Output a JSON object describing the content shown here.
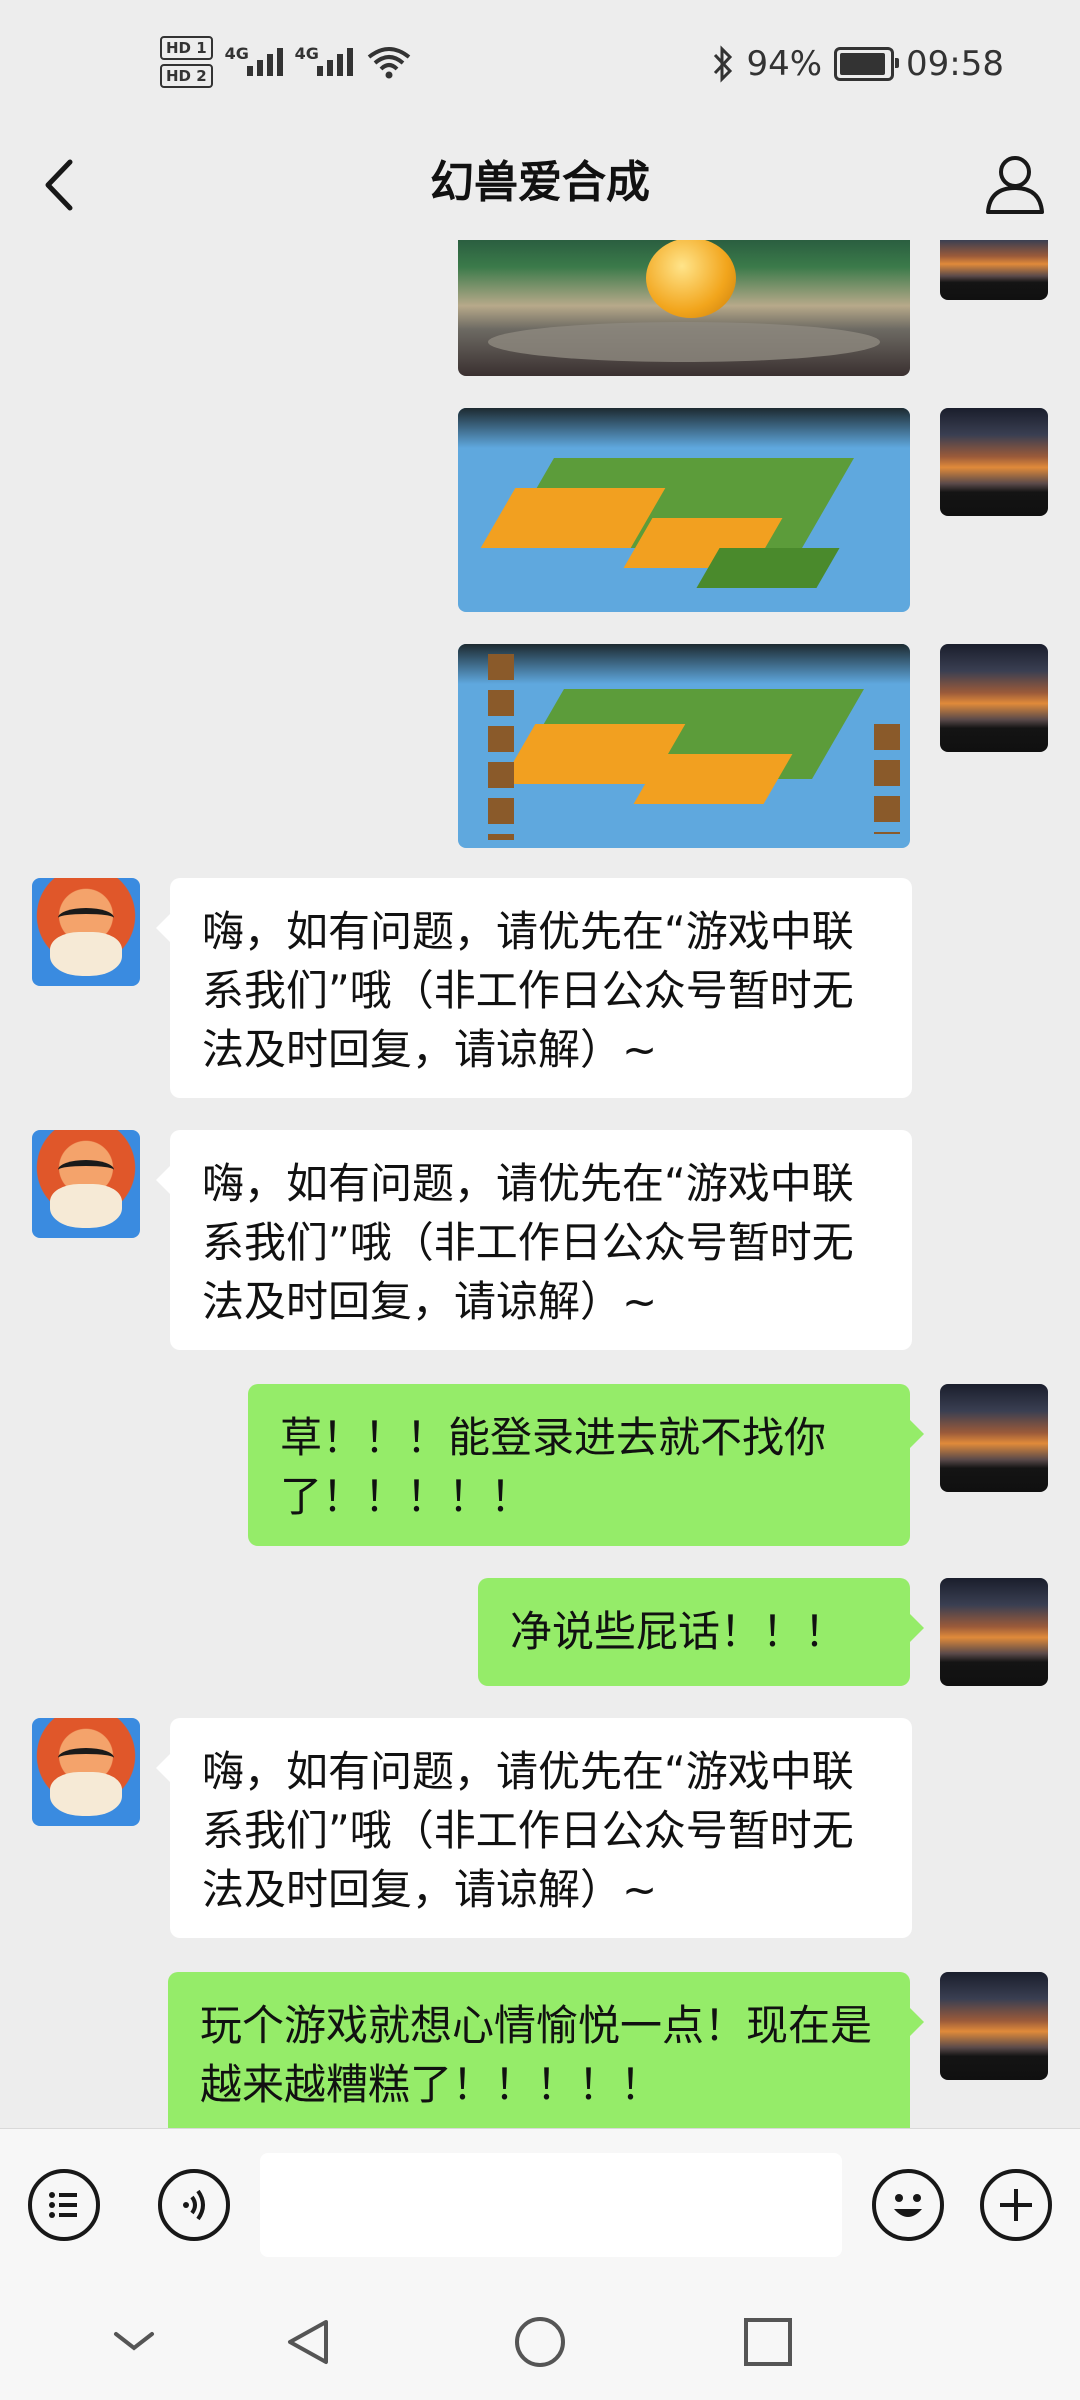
{
  "status_bar": {
    "hd1": "HD 1",
    "hd2": "HD 2",
    "net1": "4G",
    "net2": "4G",
    "battery_text": "94%",
    "battery_level": 0.94,
    "time": "09:58"
  },
  "header": {
    "title": "幻兽爱合成"
  },
  "messages": [
    {
      "type": "image",
      "from": "me",
      "content": "game-scene-egg"
    },
    {
      "type": "image",
      "from": "me",
      "content": "farm-island-screenshot"
    },
    {
      "type": "image",
      "from": "me",
      "content": "farm-island-screenshot-ui"
    },
    {
      "type": "text",
      "from": "official",
      "text": "嗨，如有问题，请优先在“游戏中联系我们”哦（非工作日公众号暂时无法及时回复，请谅解）~"
    },
    {
      "type": "text",
      "from": "official",
      "text": "嗨，如有问题，请优先在“游戏中联系我们”哦（非工作日公众号暂时无法及时回复，请谅解）~"
    },
    {
      "type": "text",
      "from": "me",
      "text": "草！！！能登录进去就不找你了！！！！！"
    },
    {
      "type": "text",
      "from": "me",
      "text": "净说些屁话！！！"
    },
    {
      "type": "text",
      "from": "official",
      "text": "嗨，如有问题，请优先在“游戏中联系我们”哦（非工作日公众号暂时无法及时回复，请谅解）~"
    },
    {
      "type": "text",
      "from": "me",
      "text": "玩个游戏就想心情愉悦一点！现在是越来越糟糕了！！！！！"
    }
  ],
  "input_bar": {
    "menu_icon": "list-menu-icon",
    "voice_icon": "voice-icon",
    "emoji_icon": "emoji-icon",
    "more_icon": "plus-icon",
    "value": ""
  },
  "system_nav": [
    "chevron-down-icon",
    "back-triangle-icon",
    "home-circle-icon",
    "recents-square-icon"
  ],
  "colors": {
    "background": "#ededed",
    "sent_bubble": "#95ec69",
    "received_bubble": "#ffffff"
  }
}
